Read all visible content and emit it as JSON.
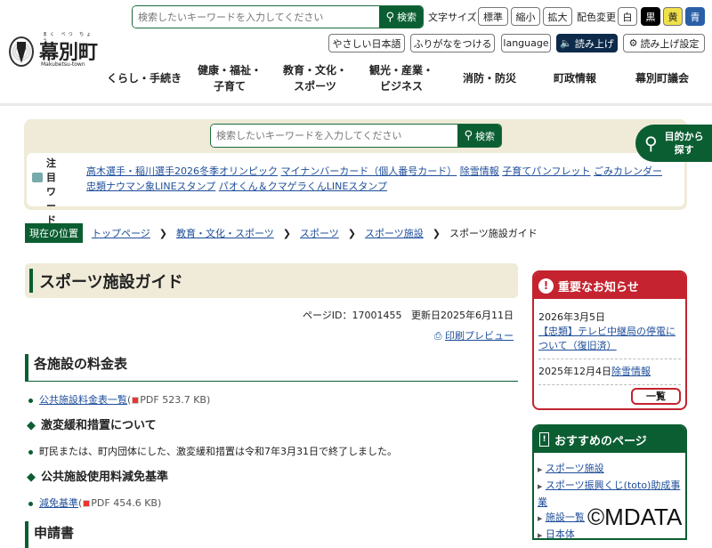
{
  "header": {
    "logo_text": "幕別町",
    "logo_ruby": "まく べつ ちょう",
    "logo_sub": "Makubetsu-town",
    "search_placeholder": "検索したいキーワードを入力してください",
    "search_button": "検索",
    "font_size_label": "文字サイズ",
    "font_sizes": [
      "標準",
      "縮小",
      "拡大"
    ],
    "color_label": "配色変更",
    "colors": [
      "白",
      "黒",
      "黄",
      "青"
    ],
    "tools": [
      "やさしい日本語",
      "ふりがなをつける",
      "language",
      "読み上げ",
      "読み上げ設定"
    ]
  },
  "nav": [
    "くらし・手続き",
    "健康・福祉・\n子育て",
    "教育・文化・\nスポーツ",
    "観光・産業・\nビジネス",
    "消防・防災",
    "町政情報",
    "幕別町議会"
  ],
  "search_box": {
    "placeholder": "検索したいキーワードを入力してください",
    "button": "検索",
    "purpose_button": "目的から探す"
  },
  "hot_words": {
    "label": "注目ワード",
    "items": [
      "高木選手・稲川選手2026冬季オリンピック",
      "マイナンバーカード（個人番号カード）",
      "除雪情報",
      "子育てパンフレット",
      "ごみカレンダー",
      "忠類ナウマン象LINEスタンプ",
      "パオくん＆クマゲラくんLINEスタンプ"
    ]
  },
  "breadcrumb": {
    "label": "現在の位置",
    "items": [
      "トップページ",
      "教育・文化・スポーツ",
      "スポーツ",
      "スポーツ施設"
    ],
    "current": "スポーツ施設ガイド"
  },
  "page": {
    "title": "スポーツ施設ガイド",
    "page_id": "ページID：17001455",
    "updated": "更新日2025年6月11日",
    "print": "印刷プレビュー",
    "sec1": "各施設の料金表",
    "sec1_link": "公共施設料金表一覧",
    "sec1_file": "PDF 523.7 KB",
    "sub1": "激変緩和措置について",
    "sub1_text": "町民または、町内団体にした、激変緩和措置は令和7年3月31日で終了しました。",
    "sub2": "公共施設使用料減免基準",
    "sub2_link": "減免基準",
    "sub2_file": "PDF 454.6 KB",
    "sec2": "申請書"
  },
  "notice": {
    "title": "重要なお知らせ",
    "items": [
      {
        "date": "2026年3月5日",
        "link": "【忠類】テレビ中継局の停電について（復旧済）"
      },
      {
        "date": "2025年12月4日",
        "link": "除雪情報"
      }
    ],
    "more": "一覧"
  },
  "recommend": {
    "title": "おすすめのページ",
    "items": [
      "スポーツ施設",
      "スポーツ振興くじ(toto)助成事業",
      "施設一覧",
      "日本体"
    ]
  },
  "watermark": "©MDATA"
}
